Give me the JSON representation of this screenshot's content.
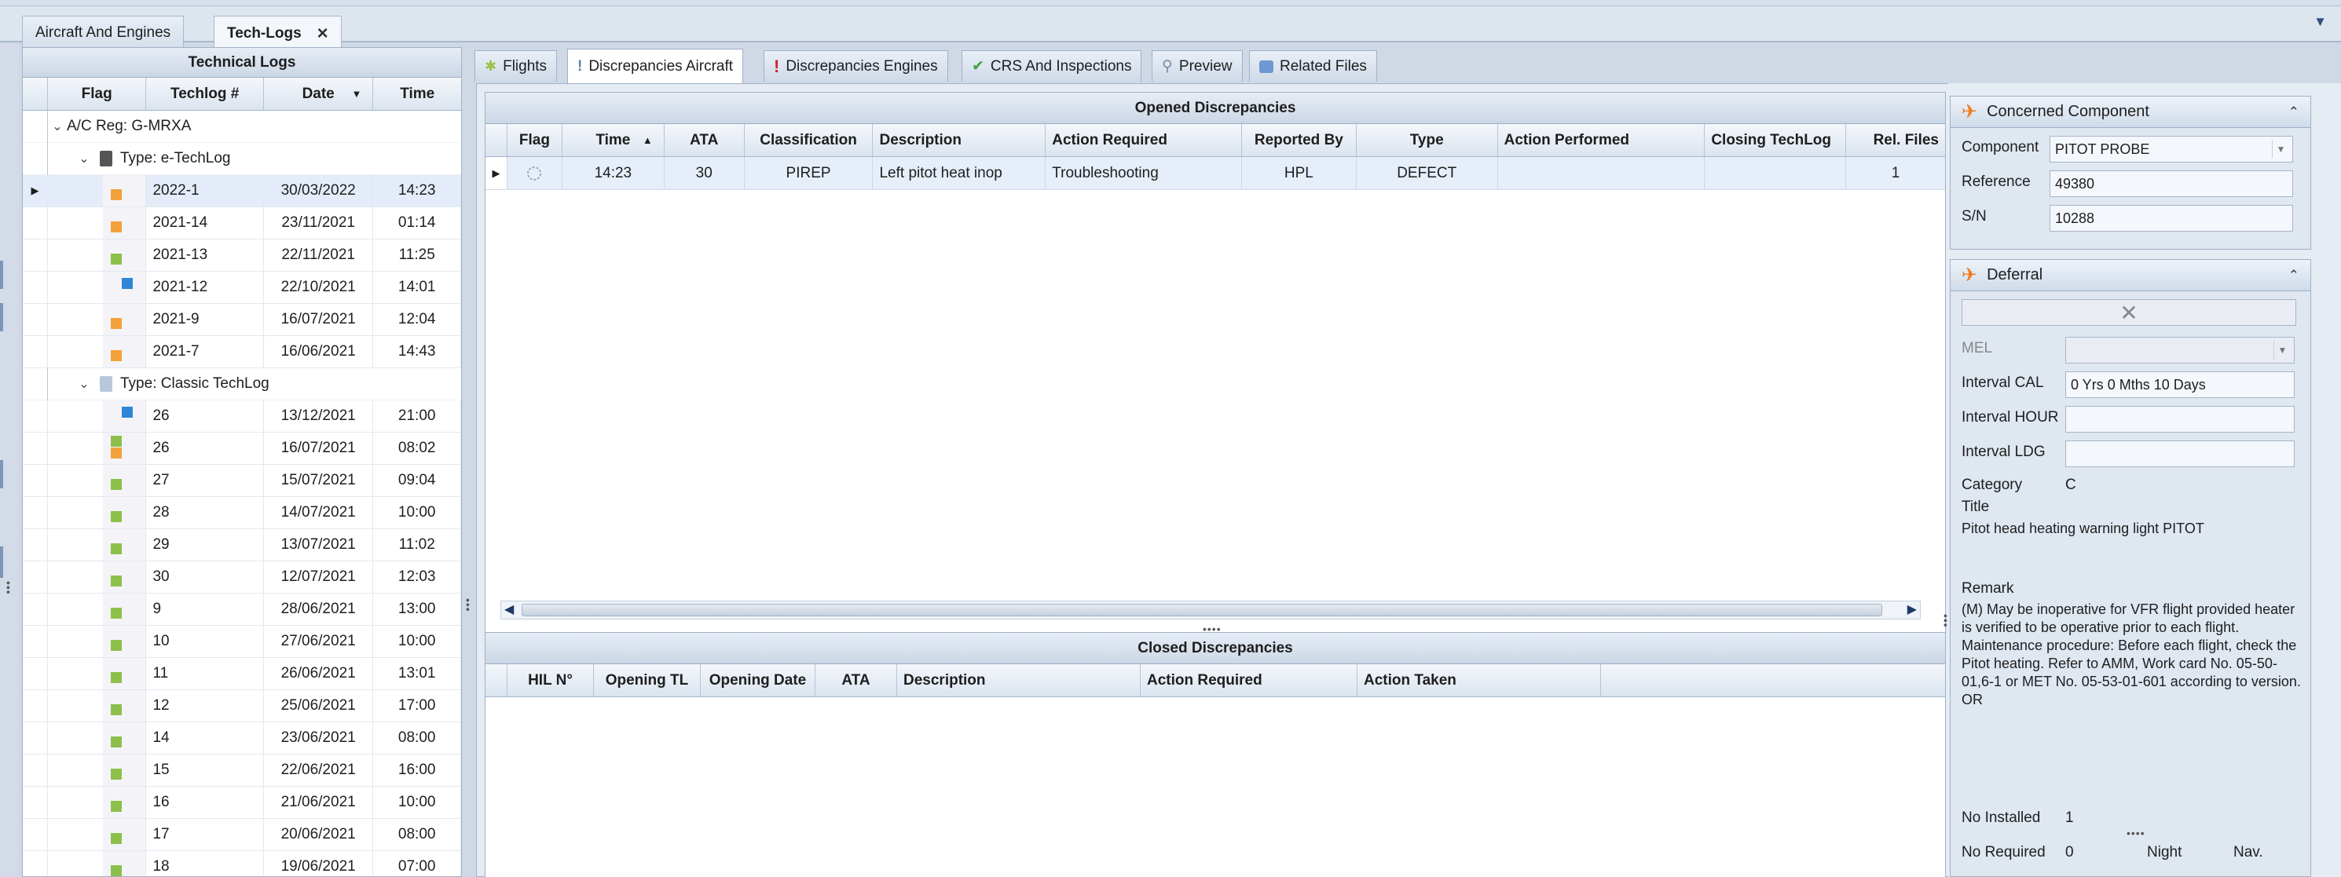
{
  "doc_tabs": [
    {
      "label": "Aircraft And Engines",
      "active": false
    },
    {
      "label": "Tech-Logs",
      "active": true
    }
  ],
  "technical_logs": {
    "title": "Technical Logs",
    "columns": [
      "Flag",
      "Techlog #",
      "Date",
      "Time"
    ],
    "group": "A/C Reg: G-MRXA",
    "subgroups": [
      {
        "label": "Type: e-TechLog",
        "rows": [
          {
            "num": "2022-1",
            "date": "30/03/2022",
            "time": "14:23",
            "flag": [
              "orange"
            ]
          },
          {
            "num": "2021-14",
            "date": "23/11/2021",
            "time": "01:14",
            "flag": [
              "orange"
            ]
          },
          {
            "num": "2021-13",
            "date": "22/11/2021",
            "time": "11:25",
            "flag": [
              "green"
            ]
          },
          {
            "num": "2021-12",
            "date": "22/10/2021",
            "time": "14:01",
            "flag": [
              "blue"
            ]
          },
          {
            "num": "2021-9",
            "date": "16/07/2021",
            "time": "12:04",
            "flag": [
              "orange"
            ]
          },
          {
            "num": "2021-7",
            "date": "16/06/2021",
            "time": "14:43",
            "flag": [
              "orange"
            ]
          }
        ]
      },
      {
        "label": "Type: Classic TechLog",
        "rows": [
          {
            "num": "26",
            "date": "13/12/2021",
            "time": "21:00",
            "flag": [
              "blue"
            ]
          },
          {
            "num": "26",
            "date": "16/07/2021",
            "time": "08:02",
            "flag": [
              "green",
              "orange"
            ]
          },
          {
            "num": "27",
            "date": "15/07/2021",
            "time": "09:04",
            "flag": [
              "green"
            ]
          },
          {
            "num": "28",
            "date": "14/07/2021",
            "time": "10:00",
            "flag": [
              "green"
            ]
          },
          {
            "num": "29",
            "date": "13/07/2021",
            "time": "11:02",
            "flag": [
              "green"
            ]
          },
          {
            "num": "30",
            "date": "12/07/2021",
            "time": "12:03",
            "flag": [
              "green"
            ]
          },
          {
            "num": "9",
            "date": "28/06/2021",
            "time": "13:00",
            "flag": [
              "green"
            ]
          },
          {
            "num": "10",
            "date": "27/06/2021",
            "time": "10:00",
            "flag": [
              "green"
            ]
          },
          {
            "num": "11",
            "date": "26/06/2021",
            "time": "13:01",
            "flag": [
              "green"
            ]
          },
          {
            "num": "12",
            "date": "25/06/2021",
            "time": "17:00",
            "flag": [
              "green"
            ]
          },
          {
            "num": "14",
            "date": "23/06/2021",
            "time": "08:00",
            "flag": [
              "green"
            ]
          },
          {
            "num": "15",
            "date": "22/06/2021",
            "time": "16:00",
            "flag": [
              "green"
            ]
          },
          {
            "num": "16",
            "date": "21/06/2021",
            "time": "10:00",
            "flag": [
              "green"
            ]
          },
          {
            "num": "17",
            "date": "20/06/2021",
            "time": "08:00",
            "flag": [
              "green"
            ]
          },
          {
            "num": "18",
            "date": "19/06/2021",
            "time": "07:00",
            "flag": [
              "green"
            ]
          }
        ]
      }
    ]
  },
  "inner_tabs": [
    {
      "label": "Flights",
      "icon": "star-icon",
      "active": false
    },
    {
      "label": "Discrepancies Aircraft",
      "icon": "info-icon",
      "active": true
    },
    {
      "label": "Discrepancies Engines",
      "icon": "exclamation-icon",
      "active": false
    },
    {
      "label": "CRS And Inspections",
      "icon": "checkmark-icon",
      "active": false
    },
    {
      "label": "Preview",
      "icon": "magnifier-icon",
      "active": false
    },
    {
      "label": "Related Files",
      "icon": "folder-icon",
      "active": false
    }
  ],
  "opened_discrepancies": {
    "title": "Opened Discrepancies",
    "columns": [
      "Flag",
      "Time",
      "ATA",
      "Classification",
      "Description",
      "Action Required",
      "Reported By",
      "Type",
      "Action Performed",
      "Closing TechLog",
      "Rel. Files"
    ],
    "rows": [
      {
        "flag": "gear-outline",
        "time": "14:23",
        "ata": "30",
        "classification": "PIREP",
        "description": "Left pitot heat inop",
        "action_required": "Troubleshooting",
        "reported_by": "HPL",
        "type": "DEFECT",
        "action_performed": "",
        "closing_techlog": "",
        "rel_files": "1"
      }
    ]
  },
  "closed_discrepancies": {
    "title": "Closed Discrepancies",
    "columns": [
      "HIL N°",
      "Opening TL",
      "Opening Date",
      "ATA",
      "Description",
      "Action Required",
      "Action Taken"
    ]
  },
  "concerned_component": {
    "title": "Concerned Component",
    "component_label": "Component",
    "component_value": "PITOT PROBE",
    "reference_label": "Reference",
    "reference_value": "49380",
    "sn_label": "S/N",
    "sn_value": "10288"
  },
  "deferral": {
    "title": "Deferral",
    "mel_label": "MEL",
    "interval_cal_label": "Interval CAL",
    "interval_cal_value": "0 Yrs 0 Mths 10 Days",
    "interval_hour_label": "Interval HOUR",
    "interval_ldg_label": "Interval LDG",
    "category_label": "Category",
    "category_value": "C",
    "title_label": "Title",
    "title_value": "Pitot head heating warning light PITOT",
    "remark_label": "Remark",
    "remark_value": "(M) May be inoperative for VFR flight provided heater is verified to be operative prior to each flight. Maintenance procedure: Before each flight, check the Pitot heating. Refer to AMM, Work card No. 05-50-01,6-1 or MET No. 05-53-01-601 according to version. OR",
    "no_installed_label": "No Installed",
    "no_installed_value": "1",
    "no_required_label": "No Required",
    "no_required_value": "0",
    "night_label": "Night",
    "nav_label": "Nav."
  },
  "colors": {
    "orange": "#f2a23a",
    "green": "#8cc04a",
    "blue": "#2f86d8",
    "accent": "#f07a1c"
  }
}
